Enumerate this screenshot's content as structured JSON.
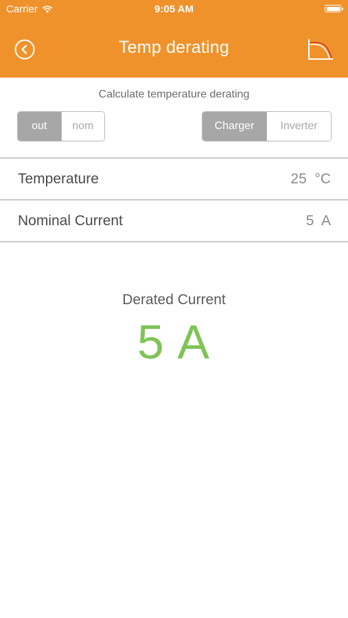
{
  "status_bar": {
    "carrier": "Carrier",
    "time": "9:05 AM",
    "wifi_icon": "wifi-icon",
    "battery_icon": "battery-icon"
  },
  "nav": {
    "title": "Temp derating",
    "back_icon": "back-circle-icon",
    "chart_icon": "derating-curve-icon"
  },
  "subtitle": "Calculate temperature derating",
  "mode_toggle": {
    "options": [
      "out",
      "nom"
    ],
    "selected": "out"
  },
  "device_toggle": {
    "options": [
      "Charger",
      "Inverter"
    ],
    "selected": "Charger"
  },
  "rows": [
    {
      "label": "Temperature",
      "value": "25  °C"
    },
    {
      "label": "Nominal Current",
      "value": "5  A"
    }
  ],
  "result": {
    "label": "Derated Current",
    "value": "5 A"
  },
  "colors": {
    "header": "#f0922c",
    "result_value": "#7ec456",
    "segment_active": "#a7a7a7"
  }
}
